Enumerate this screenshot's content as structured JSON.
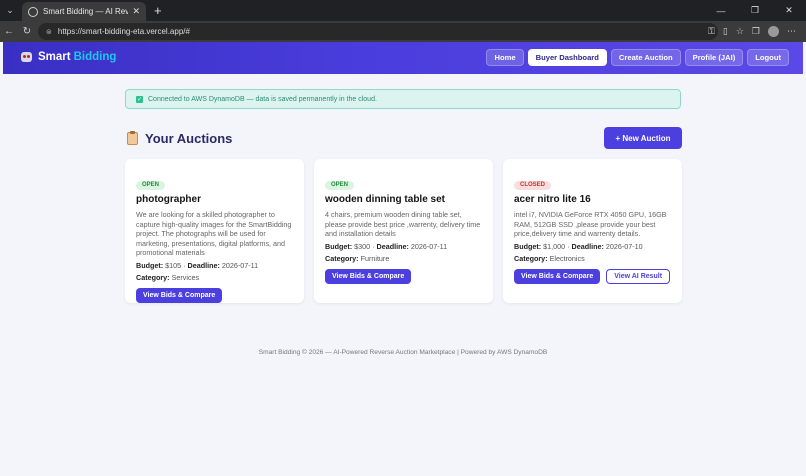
{
  "browser": {
    "tab_title": "Smart Bidding — AI Reverse Auction",
    "url": "https://smart-bidding-eta.vercel.app/#"
  },
  "header": {
    "brand_part1": "Smart",
    "brand_part2": "Bidding",
    "nav": [
      "Home",
      "Buyer Dashboard",
      "Create Auction",
      "Profile (JAI)",
      "Logout"
    ],
    "active_nav": "Buyer Dashboard",
    "accent_color": "#4c3fdf"
  },
  "notice": {
    "text": "Connected to AWS DynamoDB — data is saved permanently in the cloud.",
    "icon": "check-icon"
  },
  "section": {
    "title": "Your Auctions",
    "icon": "clipboard-icon",
    "new_auction_label": "+ New Auction"
  },
  "auctions": [
    {
      "status": "OPEN",
      "title": "photographer",
      "description": "We are looking for a skilled photographer to capture high-quality images for the SmartBidding project. The photographs will be used for marketing, presentations, digital platforms, and promotional materials",
      "budget_label": "Budget:",
      "budget": "$105",
      "deadline_label": "Deadline:",
      "deadline": "2026-07-11",
      "category_label": "Category:",
      "category": "Services",
      "primary_action": "View Bids & Compare"
    },
    {
      "status": "OPEN",
      "title": "wooden dinning table set",
      "description": "4 chairs, premium wooden dining table set, please provide best price ,warrenty, delivery time and installation details",
      "budget_label": "Budget:",
      "budget": "$300",
      "deadline_label": "Deadline:",
      "deadline": "2026-07-11",
      "category_label": "Category:",
      "category": "Furniture",
      "primary_action": "View Bids & Compare"
    },
    {
      "status": "CLOSED",
      "title": "acer nitro lite 16",
      "description": "intel i7, NVIDIA GeForce RTX 4050 GPU, 16GB RAM, 512GB SSD ,please provide your best price,delivery time and warrenty details.",
      "budget_label": "Budget:",
      "budget": "$1,000",
      "deadline_label": "Deadline:",
      "deadline": "2026-07-10",
      "category_label": "Category:",
      "category": "Electronics",
      "primary_action": "View Bids & Compare",
      "secondary_action": "View AI Result"
    }
  ],
  "footer": {
    "text": "Smart Bidding © 2026 — AI-Powered Reverse Auction Marketplace | Powered by AWS DynamoDB"
  }
}
